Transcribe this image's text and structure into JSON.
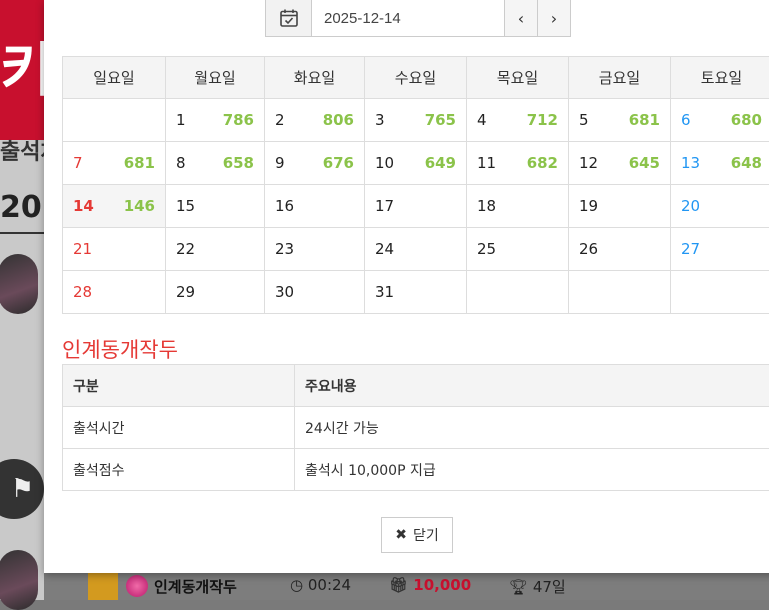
{
  "background": {
    "side_text_1": "출석체",
    "side_text_2": "20",
    "row": {
      "name": "인계동개작두",
      "time": "00:24",
      "points": "10,000",
      "days": "47일"
    }
  },
  "datepicker": {
    "value": "2025-12-14",
    "calendar_icon": "calendar-check-icon",
    "prev_icon": "chevron-left-icon",
    "next_icon": "chevron-right-icon"
  },
  "calendar": {
    "weekdays": [
      "일요일",
      "월요일",
      "화요일",
      "수요일",
      "목요일",
      "금요일",
      "토요일"
    ],
    "weeks": [
      [
        {
          "d": "",
          "c": ""
        },
        {
          "d": "1",
          "c": "786"
        },
        {
          "d": "2",
          "c": "806"
        },
        {
          "d": "3",
          "c": "765"
        },
        {
          "d": "4",
          "c": "712"
        },
        {
          "d": "5",
          "c": "681"
        },
        {
          "d": "6",
          "c": "680"
        }
      ],
      [
        {
          "d": "7",
          "c": "681"
        },
        {
          "d": "8",
          "c": "658"
        },
        {
          "d": "9",
          "c": "676"
        },
        {
          "d": "10",
          "c": "649"
        },
        {
          "d": "11",
          "c": "682"
        },
        {
          "d": "12",
          "c": "645"
        },
        {
          "d": "13",
          "c": "648"
        }
      ],
      [
        {
          "d": "14",
          "c": "146"
        },
        {
          "d": "15",
          "c": ""
        },
        {
          "d": "16",
          "c": ""
        },
        {
          "d": "17",
          "c": ""
        },
        {
          "d": "18",
          "c": ""
        },
        {
          "d": "19",
          "c": ""
        },
        {
          "d": "20",
          "c": ""
        }
      ],
      [
        {
          "d": "21",
          "c": ""
        },
        {
          "d": "22",
          "c": ""
        },
        {
          "d": "23",
          "c": ""
        },
        {
          "d": "24",
          "c": ""
        },
        {
          "d": "25",
          "c": ""
        },
        {
          "d": "26",
          "c": ""
        },
        {
          "d": "27",
          "c": ""
        }
      ],
      [
        {
          "d": "28",
          "c": ""
        },
        {
          "d": "29",
          "c": ""
        },
        {
          "d": "30",
          "c": ""
        },
        {
          "d": "31",
          "c": ""
        },
        {
          "d": "",
          "c": ""
        },
        {
          "d": "",
          "c": ""
        },
        {
          "d": "",
          "c": ""
        }
      ]
    ],
    "colors": {
      "sunday": "#e53935",
      "saturday": "#2196f3",
      "count": "#8bc34a"
    }
  },
  "info": {
    "title": "인계동개작두",
    "headers": [
      "구분",
      "주요내용"
    ],
    "rows": [
      [
        "출석시간",
        "24시간 가능"
      ],
      [
        "출석점수",
        "출석시 10,000P 지급"
      ]
    ]
  },
  "close_button": {
    "label": "닫기",
    "icon": "close-icon"
  }
}
